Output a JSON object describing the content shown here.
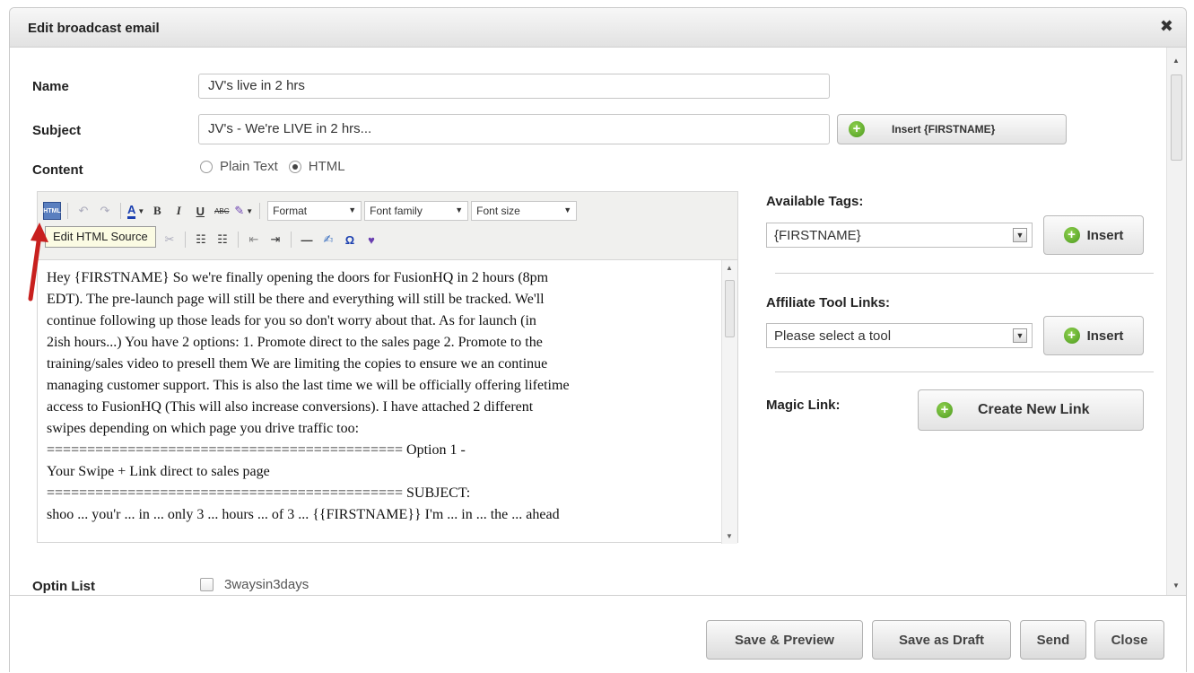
{
  "dialog": {
    "title": "Edit broadcast email",
    "close_glyph": "✖"
  },
  "form": {
    "name_label": "Name",
    "name_value": "JV's live in 2 hrs",
    "subject_label": "Subject",
    "subject_value": "JV's - We're LIVE in 2 hrs...",
    "insert_firstname_label": "Insert {FIRSTNAME}",
    "content_label": "Content",
    "content_options": [
      "Plain Text",
      "HTML"
    ],
    "content_selected": "HTML",
    "optin_label": "Optin List",
    "optin_option": "3waysin3days"
  },
  "editor": {
    "toolbar": {
      "format_select": "Format",
      "font_family_select": "Font family",
      "font_size_select": "Font size",
      "html_icon_text": "HTML",
      "bold_glyph": "B",
      "italic_glyph": "I",
      "underline_glyph": "U",
      "strike_glyph": "ABC",
      "font_color_glyph": "A",
      "omega_glyph": "Ω",
      "hr_glyph": "—"
    },
    "tooltip": "Edit HTML Source",
    "lines": [
      "Hey {FIRSTNAME} So we're finally opening the doors for FusionHQ in 2 hours (8pm",
      "EDT). The pre-launch page will still be there and everything will still be tracked. We'll",
      "continue following up those leads for you so don't worry about that. As for launch (in",
      "2ish hours...) You have 2 options: 1. Promote direct to the sales page 2. Promote to the",
      "training/sales video to presell them We are limiting the copies to ensure we an continue",
      "managing customer support. This is also the last time we will be officially offering lifetime",
      "access to FusionHQ (This will also increase conversions). I have attached 2 different",
      "swipes depending on which page you drive traffic too:",
      "============================================ Option 1 -",
      "Your Swipe + Link direct to sales page",
      "============================================ SUBJECT:",
      "shoo ... you'r ... in ... only 3 ... hours ... of 3 ... {{FIRSTNAME}} I'm ... in ... the ... ahead"
    ]
  },
  "sidebar": {
    "available_tags_label": "Available Tags:",
    "available_tags_value": "{FIRSTNAME}",
    "insert_label": "Insert",
    "affiliate_label": "Affiliate Tool Links:",
    "affiliate_placeholder": "Please select a tool",
    "magic_link_label": "Magic Link:",
    "create_link_label": "Create New Link"
  },
  "footer": {
    "buttons": [
      "Save & Preview",
      "Save as Draft",
      "Send",
      "Close"
    ]
  },
  "colors": {
    "accent_green": "#5aa829",
    "arrow_red": "#c8201e"
  }
}
